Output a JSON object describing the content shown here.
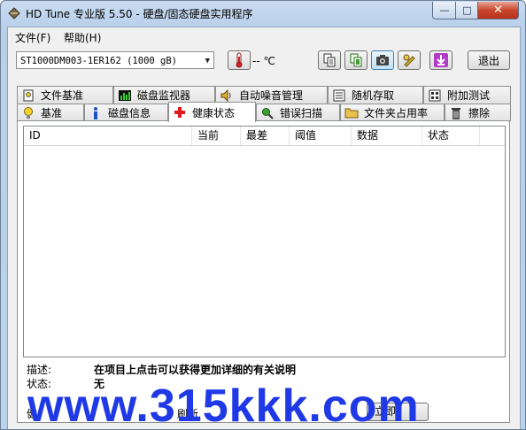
{
  "window": {
    "title": "HD Tune 专业版 5.50 - 硬盘/固态硬盘实用程序",
    "min_glyph": "—",
    "max_glyph": "□",
    "close_glyph": "✕"
  },
  "menu": {
    "file": "文件(F)",
    "help": "帮助(H)"
  },
  "toolbar": {
    "drive": "ST1000DM003-1ER162 (1000 gB)",
    "temperature": "-- ℃",
    "exit_label": "退出",
    "icons": [
      "copy-icon",
      "copy-green-icon",
      "camera-icon",
      "tools-icon",
      "download-arrow-icon"
    ]
  },
  "tabs_top": [
    {
      "label": "文件基准",
      "icon": "file-benchmark-icon"
    },
    {
      "label": "磁盘监视器",
      "icon": "disk-monitor-icon"
    },
    {
      "label": "自动噪音管理",
      "icon": "speaker-icon"
    },
    {
      "label": "随机存取",
      "icon": "random-access-icon"
    },
    {
      "label": "附加测试",
      "icon": "extra-tests-icon"
    }
  ],
  "tabs_bottom": [
    {
      "label": "基准",
      "icon": "lightbulb-icon"
    },
    {
      "label": "磁盘信息",
      "icon": "info-icon"
    },
    {
      "label": "健康状态",
      "icon": "red-cross-icon",
      "active": true
    },
    {
      "label": "错误扫描",
      "icon": "magnifier-icon"
    },
    {
      "label": "文件夹占用率",
      "icon": "folder-icon"
    },
    {
      "label": "擦除",
      "icon": "trash-icon"
    }
  ],
  "health_table": {
    "columns": [
      "ID",
      "当前",
      "最差",
      "阈值",
      "数据",
      "状态"
    ],
    "rows": []
  },
  "details": {
    "description_label": "描述:",
    "description_value": "在项目上点击可以获得更加详细的有关说明",
    "status_label": "状态:",
    "status_value": "无"
  },
  "bottom": {
    "left_label": "健",
    "refresh_partial": "刷新",
    "refresh_button_partial": "立即"
  },
  "watermark": "www.315kkk.com",
  "colors": {
    "watermark": "#1f39e6",
    "close_button": "#c9462c",
    "title_gradient": "#c9dcf2"
  }
}
